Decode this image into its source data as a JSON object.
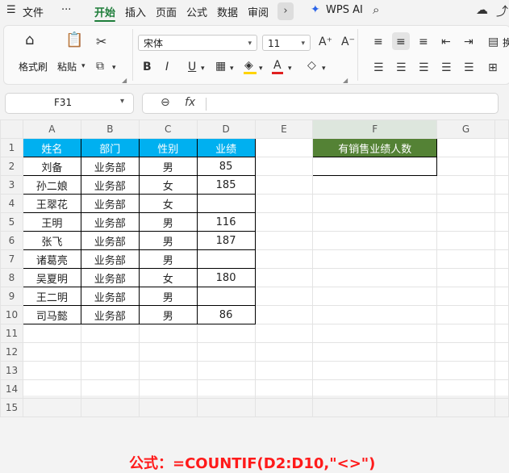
{
  "menubar": {
    "file": "文件",
    "more": "···",
    "tabs": [
      "开始",
      "插入",
      "页面",
      "公式",
      "数据",
      "审阅"
    ],
    "active_tab": "开始",
    "wps_ai": "WPS AI"
  },
  "ribbon": {
    "format_painter": "格式刷",
    "paste": "粘贴",
    "font_name": "宋体",
    "font_size": "11",
    "bold": "B",
    "italic": "I",
    "underline": "U",
    "font_color_glyph": "A",
    "grow_font_glyph": "A⁺",
    "shrink_font_glyph": "A⁻",
    "partial_label": "换"
  },
  "formula_bar": {
    "cell_ref": "F31",
    "fx": "fx",
    "value": ""
  },
  "columns": [
    "A",
    "B",
    "C",
    "D",
    "E",
    "F",
    "G"
  ],
  "rows": [
    "1",
    "2",
    "3",
    "4",
    "5",
    "6",
    "7",
    "8",
    "9",
    "10",
    "11",
    "12",
    "13",
    "14",
    "15"
  ],
  "table": {
    "headers": [
      "姓名",
      "部门",
      "性别",
      "业绩"
    ],
    "data": [
      [
        "刘备",
        "业务部",
        "男",
        "85"
      ],
      [
        "孙二娘",
        "业务部",
        "女",
        "185"
      ],
      [
        "王翠花",
        "业务部",
        "女",
        ""
      ],
      [
        "王明",
        "业务部",
        "男",
        "116"
      ],
      [
        "张飞",
        "业务部",
        "男",
        "187"
      ],
      [
        "诸葛亮",
        "业务部",
        "男",
        ""
      ],
      [
        "吴夏明",
        "业务部",
        "女",
        "180"
      ],
      [
        "王二明",
        "业务部",
        "男",
        ""
      ],
      [
        "司马懿",
        "业务部",
        "男",
        "86"
      ]
    ]
  },
  "result": {
    "header": "有销售业绩人数",
    "value": ""
  },
  "formula_note": "公式：=COUNTIF(D2:D10,\"<>\")",
  "colors": {
    "accent_green": "#1e7d3a",
    "header_blue": "#00b0f0",
    "result_green": "#548235",
    "note_red": "#ff1a1a"
  }
}
